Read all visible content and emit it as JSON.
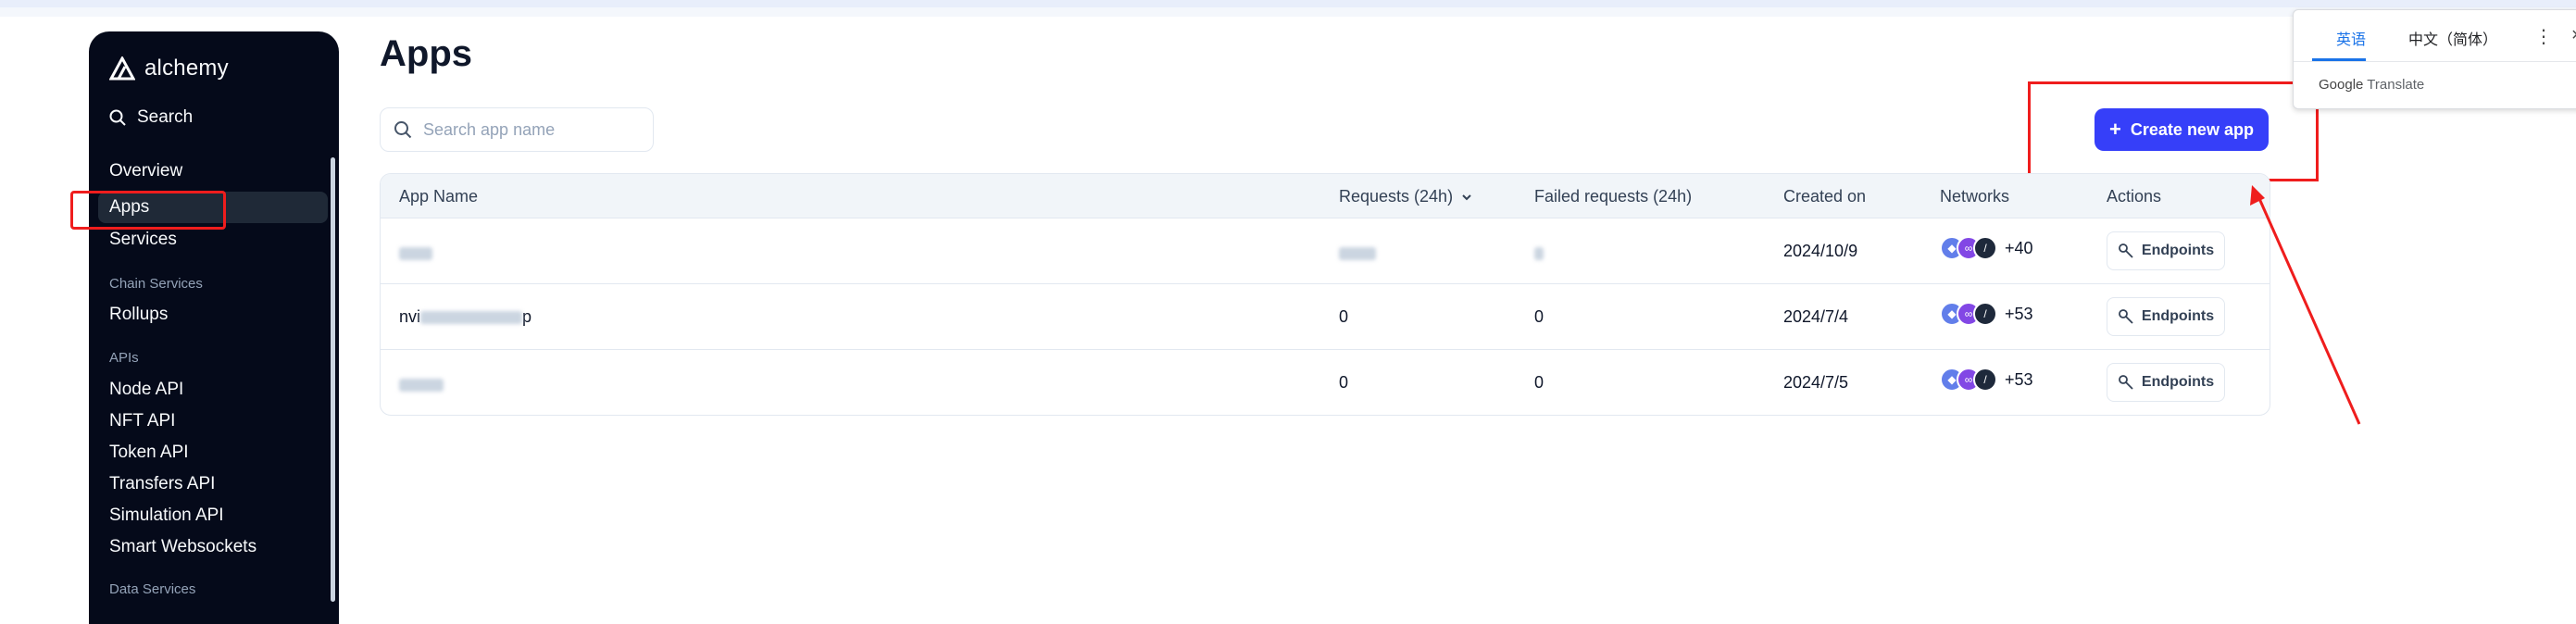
{
  "sidebar": {
    "brand": "alchemy",
    "search_label": "Search",
    "items": [
      {
        "label": "Overview"
      },
      {
        "label": "Apps"
      },
      {
        "label": "Services"
      }
    ],
    "chain_services_label": "Chain Services",
    "chain_items": [
      {
        "label": "Rollups"
      }
    ],
    "apis_label": "APIs",
    "api_items": [
      {
        "label": "Node API"
      },
      {
        "label": "NFT API"
      },
      {
        "label": "Token API"
      },
      {
        "label": "Transfers API"
      },
      {
        "label": "Simulation API"
      },
      {
        "label": "Smart Websockets"
      }
    ],
    "data_services_label": "Data Services"
  },
  "main": {
    "title": "Apps",
    "search_placeholder": "Search app name",
    "create_button": "Create new app",
    "table": {
      "headers": [
        "App Name",
        "Requests (24h)",
        "Failed requests (24h)",
        "Created on",
        "Networks",
        "Actions"
      ],
      "rows": [
        {
          "name": "",
          "requests": "",
          "failed": "",
          "created": "2024/10/9",
          "networks_extra": "+40",
          "action": "Endpoints"
        },
        {
          "name": "nvi",
          "name_tail": "p",
          "requests": "0",
          "failed": "0",
          "created": "2024/7/4",
          "networks_extra": "+53",
          "action": "Endpoints"
        },
        {
          "name": "",
          "requests": "0",
          "failed": "0",
          "created": "2024/7/5",
          "networks_extra": "+53",
          "action": "Endpoints"
        }
      ]
    }
  },
  "translate": {
    "tab_source": "英语",
    "tab_target": "中文（简体）",
    "footer_brand": "Google",
    "footer_text": "Translate"
  },
  "colors": {
    "accent": "#363ff9",
    "sidebar_bg": "#050a1a",
    "highlight": "#ef1d1d"
  }
}
